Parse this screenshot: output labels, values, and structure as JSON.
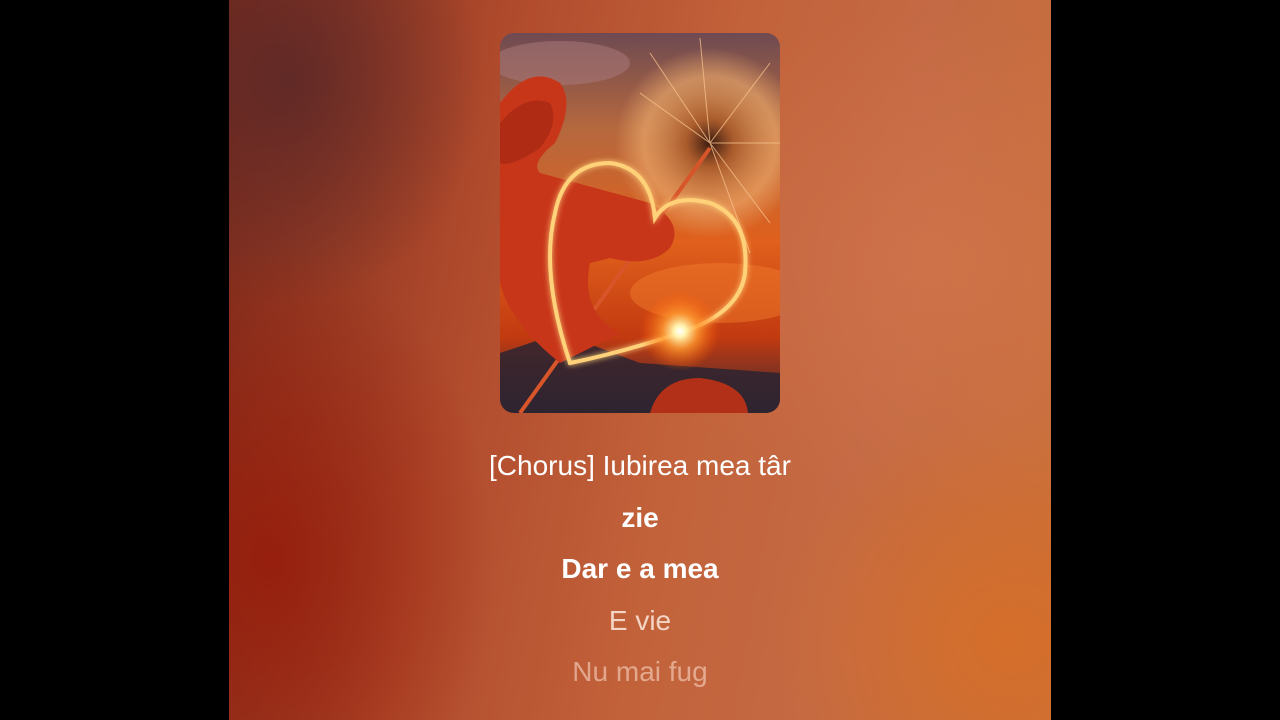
{
  "player": {
    "cover_art": "heart-sparkler-dandelion-sunset",
    "colors": {
      "letterbox": "#000000",
      "background_dark": "#7a2a1c",
      "background_light": "#c9703a",
      "lyric_active": "#ffffff"
    }
  },
  "lyrics": {
    "lines": [
      {
        "text": "[Chorus] Iubirea mea târ",
        "state": "current"
      },
      {
        "text": "zie",
        "state": "current"
      },
      {
        "text": "Dar e a mea",
        "state": "current"
      },
      {
        "text": "E vie",
        "state": "upcoming"
      },
      {
        "text": "Nu mai fug",
        "state": "upcoming"
      }
    ]
  }
}
